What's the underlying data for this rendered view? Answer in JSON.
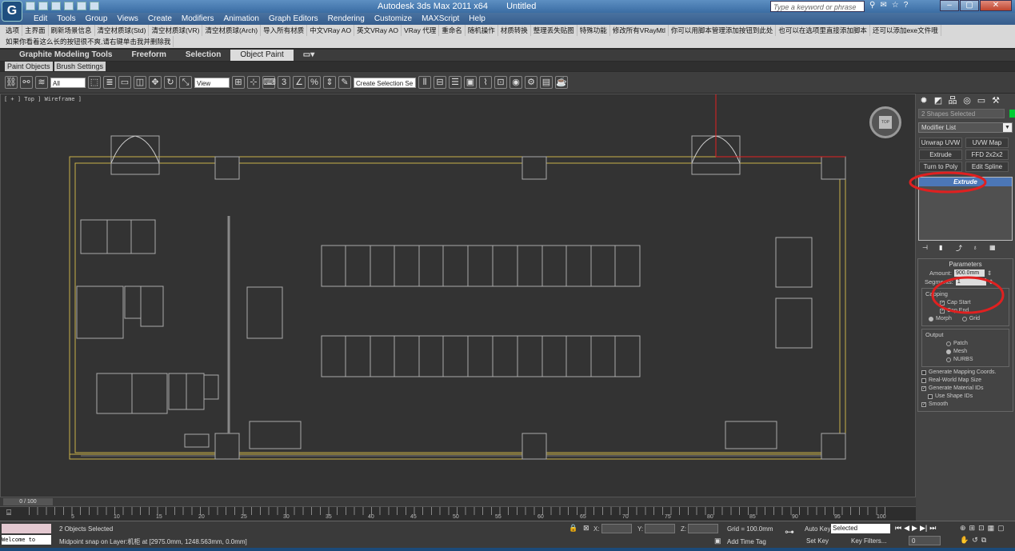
{
  "window": {
    "app_title": "Autodesk 3ds Max  2011 x64",
    "file_title": "Untitled",
    "search_placeholder": "Type a keyword or phrase",
    "min": "–",
    "max": "▢",
    "close": "✕"
  },
  "menu": [
    "Edit",
    "Tools",
    "Group",
    "Views",
    "Create",
    "Modifiers",
    "Animation",
    "Graph Editors",
    "Rendering",
    "Customize",
    "MAXScript",
    "Help"
  ],
  "cn_toolbar": {
    "row1": [
      "选项",
      "主界面",
      "刷新场景信息",
      "清空材质球(Std)",
      "清空材质球(VR)",
      "清空材质球(Arch)",
      "导入所有材质",
      "中文VRay AO",
      "英文VRay AO",
      "VRay 代理",
      "重命名",
      "随机操作",
      "材质转换",
      "整理丢失贴图",
      "特殊功能",
      "修改所有VRayMtl",
      "你可以用脚本管理添加按钮到此处",
      "也可以在选项里直接添加脚本",
      "还可以添加exe文件哦"
    ],
    "row2": [
      "如果你看着这么长的按钮很不爽,请右键单击我并删除我"
    ]
  },
  "ribbon": {
    "tabs": [
      "Graphite Modeling Tools",
      "Freeform",
      "Selection",
      "Object Paint"
    ],
    "active_tab": "Object Paint",
    "sub_tabs": [
      "Paint Objects",
      "Brush Settings"
    ]
  },
  "toolbar": {
    "filter": "All",
    "ref_coord": "View",
    "named_selection": "Create Selection Se"
  },
  "viewport": {
    "label": "[ + ] Top ] Wireframe ]",
    "viewcube": "TOP"
  },
  "command_panel": {
    "selection_name": "2 Shapes Selected",
    "modifier_list": "Modifier List",
    "mod_buttons": [
      "Unwrap UVW",
      "UVW Map",
      "Extrude",
      "FFD 2x2x2",
      "Turn to Poly",
      "Edit Spline"
    ],
    "stack_item": "Extrude",
    "parameters_title": "Parameters",
    "amount_label": "Amount:",
    "amount_value": "900.0mm",
    "segments_label": "Segments:",
    "segments_value": "1",
    "capping_title": "Capping",
    "cap_start": "Cap Start",
    "cap_end": "Cap End",
    "morph": "Morph",
    "grid": "Grid",
    "output_title": "Output",
    "patch": "Patch",
    "mesh": "Mesh",
    "nurbs": "NURBS",
    "gen_mapping": "Generate Mapping Coords.",
    "real_world": "Real-World Map Size",
    "gen_mat_ids": "Generate Material IDs",
    "use_shape_ids": "Use Shape IDs",
    "smooth": "Smooth"
  },
  "timeline": {
    "slider": "0 / 100",
    "ticks": [
      "5",
      "10",
      "15",
      "20",
      "25",
      "30",
      "35",
      "40",
      "45",
      "50",
      "55",
      "60",
      "65",
      "70",
      "75",
      "80",
      "85",
      "90",
      "95",
      "100"
    ]
  },
  "status": {
    "maxscript": "Welcome to MAX!",
    "selected": "2 Objects Selected",
    "prompt": "Midpoint snap on Layer:机柜 at [2975.0mm, 1248.563mm, 0.0mm]",
    "x_label": "X:",
    "y_label": "Y:",
    "z_label": "Z:",
    "grid": "Grid = 100.0mm",
    "add_time_tag": "Add Time Tag",
    "auto_key": "Auto Key",
    "set_key": "Set Key",
    "key_mode": "Selected",
    "key_filters": "Key Filters...",
    "frame": "0"
  },
  "colors": {
    "annotation_red": "#e02020",
    "wall_yellow": "#c9b04a",
    "selection_blue": "#4c77b7"
  }
}
